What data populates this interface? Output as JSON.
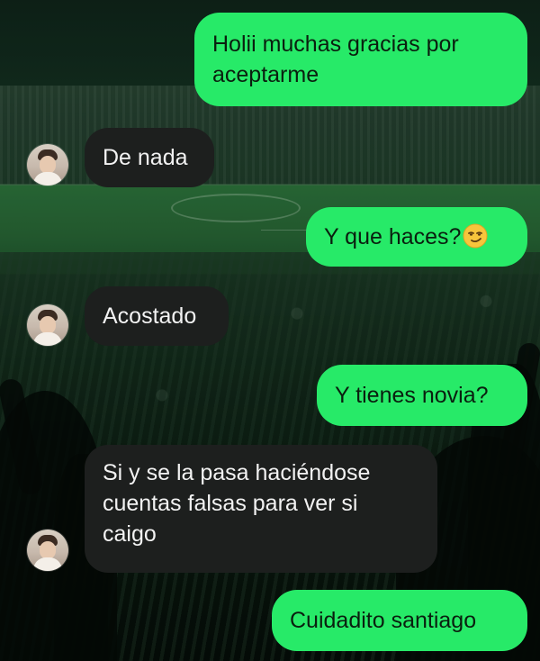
{
  "messages": [
    {
      "id": "m1",
      "direction": "outgoing",
      "lines": [
        "Holii muchas gracias por",
        "aceptarme"
      ]
    },
    {
      "id": "m2",
      "direction": "incoming",
      "lines": [
        "De nada"
      ]
    },
    {
      "id": "m3",
      "direction": "outgoing",
      "lines": [
        "Y que haces?"
      ],
      "emoji": "smirking-face-icon"
    },
    {
      "id": "m4",
      "direction": "incoming",
      "lines": [
        "Acostado"
      ]
    },
    {
      "id": "m5",
      "direction": "outgoing",
      "lines": [
        "Y tienes novia?"
      ]
    },
    {
      "id": "m6",
      "direction": "incoming",
      "lines": [
        "Si y se la pasa haciéndose",
        "cuentas falsas para ver si",
        "caigo"
      ]
    },
    {
      "id": "m7",
      "direction": "outgoing",
      "lines": [
        "Cuidadito santiago"
      ]
    }
  ],
  "avatar_icon": "contact-avatar-icon",
  "colors": {
    "outgoing_bubble": "#27ea68",
    "incoming_bubble": "#1d1f1e",
    "outgoing_text": "#0a1f0f",
    "incoming_text": "#f2f2f2"
  }
}
